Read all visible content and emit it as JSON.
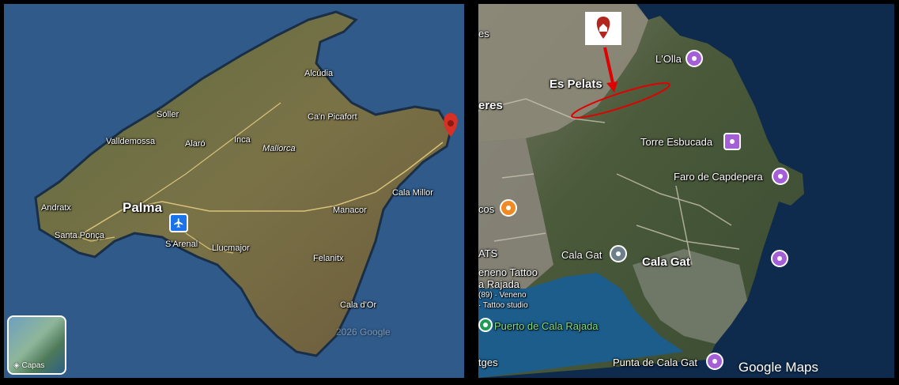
{
  "left_map": {
    "labels": {
      "alcudia": "Alcúdia",
      "soller": "Sóller",
      "capicafort": "Ca'n Picafort",
      "valldemossa": "Valldemossa",
      "alaro": "Alaró",
      "inca": "Inca",
      "mallorca": "Mallorca",
      "cala_millor": "Cala Millor",
      "andratx": "Andratx",
      "palma": "Palma",
      "manacor": "Manacor",
      "santa_ponca": "Santa Ponça",
      "sarenal": "S'Arenal",
      "llucmajor": "Llucmajor",
      "felanitx": "Felanitx",
      "cala_dor": "Cala d'Or"
    },
    "layers_label": "Capas",
    "watermark": "2026 Google"
  },
  "right_map": {
    "labels": {
      "lolla": "L'Olla",
      "es_pelats": "Es Pelats",
      "eres": "eres",
      "torre": "Torre Esbucada",
      "faro": "Faro de Capdepera",
      "cos": "cos",
      "ats": "ATS",
      "cala_gat_poi": "Cala Gat",
      "cala_gat_area": "Cala Gat",
      "veneno1": "eneno Tattoo",
      "veneno2": "a Rajada",
      "veneno3": "(89) · Veneno",
      "veneno4": "· Tattoo studio",
      "puerto": "Puerto de Cala Rajada",
      "punta": "Punta de Cala Gat",
      "tges": "tges",
      "top_s": "es"
    },
    "branding": "Google Maps"
  },
  "colors": {
    "marker_red": "#d93025",
    "annotation_red": "#e00000",
    "poi_purple": "#a45fd6",
    "road_yellow": "#d8c27a"
  }
}
